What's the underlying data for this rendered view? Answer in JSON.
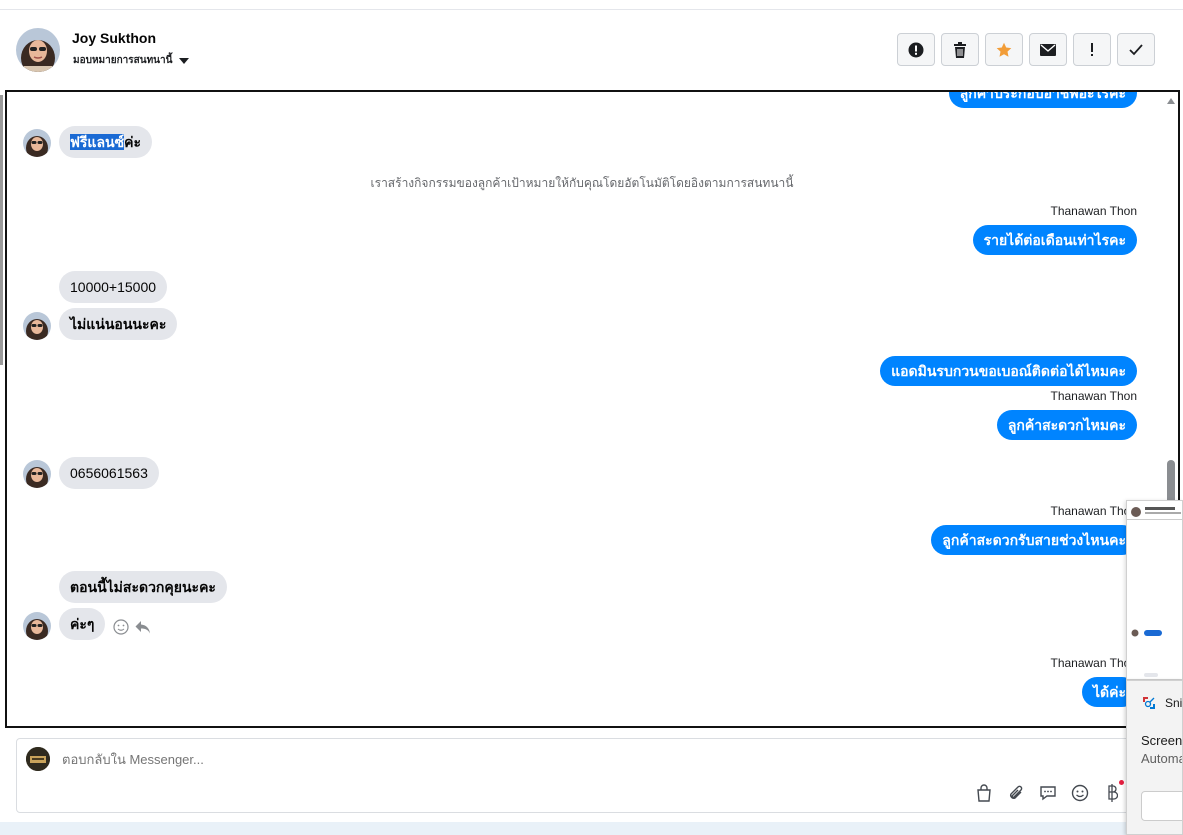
{
  "header": {
    "contact_name": "Joy Sukthon",
    "assign_label": "มอบหมายการสนทนานี้",
    "actions": [
      {
        "name": "report-icon",
        "glyph": "!",
        "label": "Report"
      },
      {
        "name": "trash-icon",
        "glyph": "🗑",
        "label": "Delete"
      },
      {
        "name": "star-icon",
        "glyph": "★",
        "label": "Star"
      },
      {
        "name": "envelope-icon",
        "glyph": "✉",
        "label": "Mark unread"
      },
      {
        "name": "exclamation-icon",
        "glyph": "!",
        "label": "Spam"
      },
      {
        "name": "check-icon",
        "glyph": "✓",
        "label": "Done"
      }
    ]
  },
  "conversation": {
    "top_partial_outgoing": "ลูกค้าประกอบอาชีพอะไรคะ",
    "msg_freelance_highlighted": "ฟรีแลนซ์",
    "msg_freelance_rest": "ค่ะ",
    "system_note": "เราสร้างกิจกรรมของลูกค้าเป้าหมายให้กับคุณโดยอัตโนมัติโดยอิงตามการสนทนานี้",
    "sender_1": "Thanawan Thon",
    "out_income": "รายได้ต่อเดือนเท่าไรคะ",
    "in_income": "10000+15000",
    "in_unsure": "ไม่แน่นอนนะคะ",
    "out_ask_phone": "แอดมินรบกวนขอเบอณ์ติดต่อได้ไหมคะ",
    "sender_2": "Thanawan Thon",
    "out_convenient": "ลูกค้าสะดวกไหมคะ",
    "in_phone": "0656061563",
    "sender_3": "Thanawan Thon",
    "out_call_time": "ลูกค้าสะดวกรับสายช่วงไหนคะ",
    "in_not_now": "ตอนนี้ไม่สะดวกคุยนะคะ",
    "in_ok": "ค่ะๆ",
    "sender_4": "Thanawan Thon",
    "out_ok": "ได้ค่ะ"
  },
  "composer": {
    "placeholder": "ตอบกลับใน Messenger...",
    "tools": [
      "shopping-bag-icon",
      "paperclip-icon",
      "saved-reply-icon",
      "emoji-icon",
      "baht-icon"
    ]
  },
  "snip_notification": {
    "app": "Snipping Tool",
    "body": "Screenshot copied to clipboard",
    "sub": "Automatically saved to screenshots folder"
  }
}
